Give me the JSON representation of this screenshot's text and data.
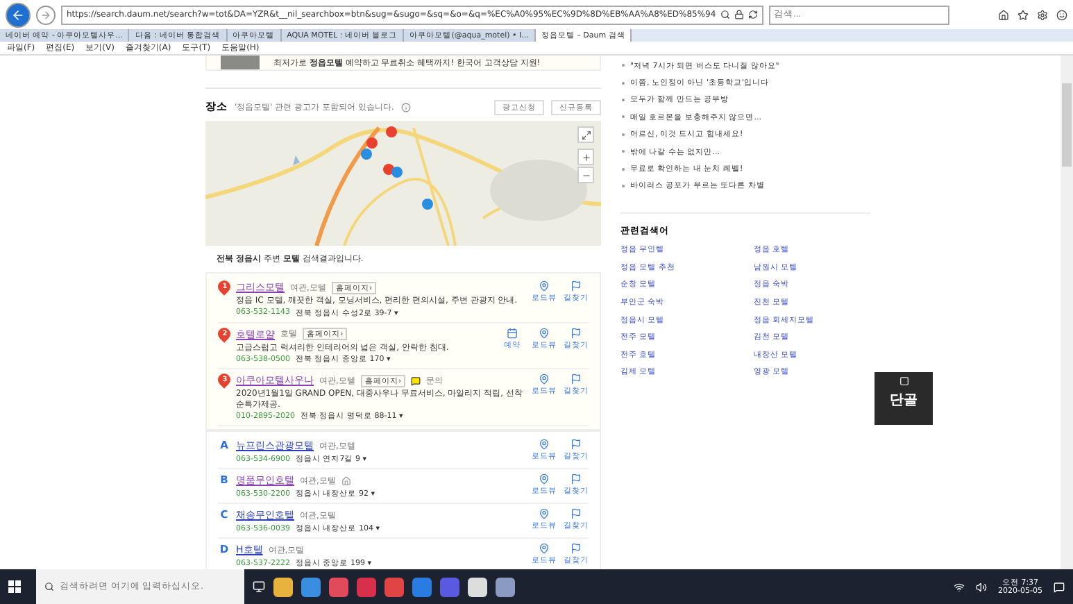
{
  "browser": {
    "url": "https://search.daum.net/search?w=tot&DA=YZR&t__nil_searchbox=btn&sug=&sugo=&sq=&o=&q=%EC%A0%95%EC%9D%8D%EB%AA%A8%ED%85%94",
    "search_placeholder": "검색...",
    "tabs": [
      {
        "label": "네이버 예약 - 아쿠아모텔사우...",
        "selected": false
      },
      {
        "label": "다음 : 네이버 통합검색",
        "selected": false
      },
      {
        "label": "아쿠아모텔",
        "selected": false
      },
      {
        "label": "AQUA MOTEL : 네이버 블로그",
        "selected": false
      },
      {
        "label": "아쿠아모텔(@aqua_motel) • I...",
        "selected": false
      },
      {
        "label": "정읍모텔 – Daum 검색",
        "selected": true
      }
    ],
    "menu": [
      "파일(F)",
      "편집(E)",
      "보기(V)",
      "즐겨찾기(A)",
      "도구(T)",
      "도움말(H)"
    ]
  },
  "banner": {
    "text": "최저가로 **정읍모텔** 예약하고 무료취소 혜택까지! 한국어 고객상담 지원!"
  },
  "places": {
    "title": "장소",
    "notice": "'정읍모텔' 관련 광고가 포함되어 있습니다.",
    "buttons": [
      "광고신청",
      "신규등록"
    ],
    "summary": "**전북 정읍시** 주변 **모텔** 검색결과입니다.",
    "ads": [
      {
        "marker": "1",
        "name": "그리스모텔",
        "visited": true,
        "category": "여관,모텔",
        "homepage": "홈페이지›",
        "description": "정읍 IC 모텔, 깨끗한 객실, 모닝서비스, 편리한 편의시설, 주변 관광지 안내.",
        "phone": "063-532-1143",
        "address": "전북 정읍시 수성2로 39-7 ▾",
        "actions": [
          {
            "kind": "roadview",
            "label": "로드뷰"
          },
          {
            "kind": "directions",
            "label": "길찾기"
          }
        ]
      },
      {
        "marker": "2",
        "name": "호텔로얄",
        "visited": true,
        "category": "호텔",
        "homepage": "홈페이지›",
        "description": "고급스럽고 럭셔리한 인테리어의 넓은 객실, 안락한 침대.",
        "phone": "063-538-0500",
        "address": "전북 정읍시 중앙로 170 ▾",
        "actions": [
          {
            "kind": "reserve",
            "label": "예약"
          },
          {
            "kind": "roadview",
            "label": "로드뷰"
          },
          {
            "kind": "directions",
            "label": "길찾기"
          }
        ]
      },
      {
        "marker": "3",
        "name": "아쿠아모텔사우나",
        "visited": true,
        "category": "여관,모텔",
        "homepage": "홈페이지›",
        "talk": "문의",
        "description": "2020년1월1일 GRAND OPEN, 대중사우나 무료서비스, 마일리지 적립, 선착순특가제공.",
        "phone": "010-2895-2020",
        "address": "전북 정읍시 명덕로 88-11 ▾",
        "actions": [
          {
            "kind": "roadview",
            "label": "로드뷰"
          },
          {
            "kind": "directions",
            "label": "길찾기"
          }
        ]
      }
    ],
    "results": [
      {
        "marker": "A",
        "name": "뉴프린스관광모텔",
        "visited": false,
        "category": "여관,모텔",
        "home_icon": false,
        "phone": "063-534-6900",
        "address": "정읍시 연지7길 9 ▾",
        "actions": [
          {
            "kind": "roadview",
            "label": "로드뷰"
          },
          {
            "kind": "directions",
            "label": "길찾기"
          }
        ]
      },
      {
        "marker": "B",
        "name": "명품무인호텔",
        "visited": true,
        "category": "여관,모텔",
        "home_icon": true,
        "phone": "063-530-2200",
        "address": "정읍시 내장산로 92 ▾",
        "actions": [
          {
            "kind": "roadview",
            "label": "로드뷰"
          },
          {
            "kind": "directions",
            "label": "길찾기"
          }
        ]
      },
      {
        "marker": "C",
        "name": "채송무인호텔",
        "visited": false,
        "category": "여관,모텔",
        "home_icon": false,
        "phone": "063-536-0039",
        "address": "정읍시 내장산로 104 ▾",
        "actions": [
          {
            "kind": "roadview",
            "label": "로드뷰"
          },
          {
            "kind": "directions",
            "label": "길찾기"
          }
        ]
      },
      {
        "marker": "D",
        "name": "H호텔",
        "visited": false,
        "category": "여관,모텔",
        "home_icon": false,
        "phone": "063-537-2222",
        "address": "정읍시 중앙로 199 ▾",
        "actions": [
          {
            "kind": "roadview",
            "label": "로드뷰"
          },
          {
            "kind": "directions",
            "label": "길찾기"
          }
        ]
      }
    ]
  },
  "sidebar": {
    "stories": [
      "\"저녁 7시가 되면 버스도 다니질 않아요\"",
      "이쯤, 노인정이 아닌 '초등학교'입니다",
      "모두가 함께 만드는 공부방",
      "매일 호르몬을 보충해주지 않으면...",
      "어르신, 이것 드시고 힘내세요!",
      "밖에 나갈 수는 없지만...",
      "무료로 확인하는 내 눈치 레벨!",
      "바이러스 공포가 부르는 또다른 차별"
    ],
    "related_title": "관련검색어",
    "related": [
      "정읍 무인텔",
      "정읍 호텔",
      "정읍 모텔 추천",
      "남원시 모텔",
      "순창 모텔",
      "정읍 숙박",
      "부안군 숙박",
      "진천 모텔",
      "정읍시 모텔",
      "정읍 회세지모텔",
      "전주 모텔",
      "김천 모텔",
      "전주 호텔",
      "내장산 모텔",
      "김제 모텔",
      "영광 모텔"
    ]
  },
  "widget": {
    "label": "단골"
  },
  "taskbar": {
    "search_placeholder": "검색하려면 여기에 입력하십시오.",
    "time": "오전 7:37",
    "date": "2020-05-05"
  }
}
